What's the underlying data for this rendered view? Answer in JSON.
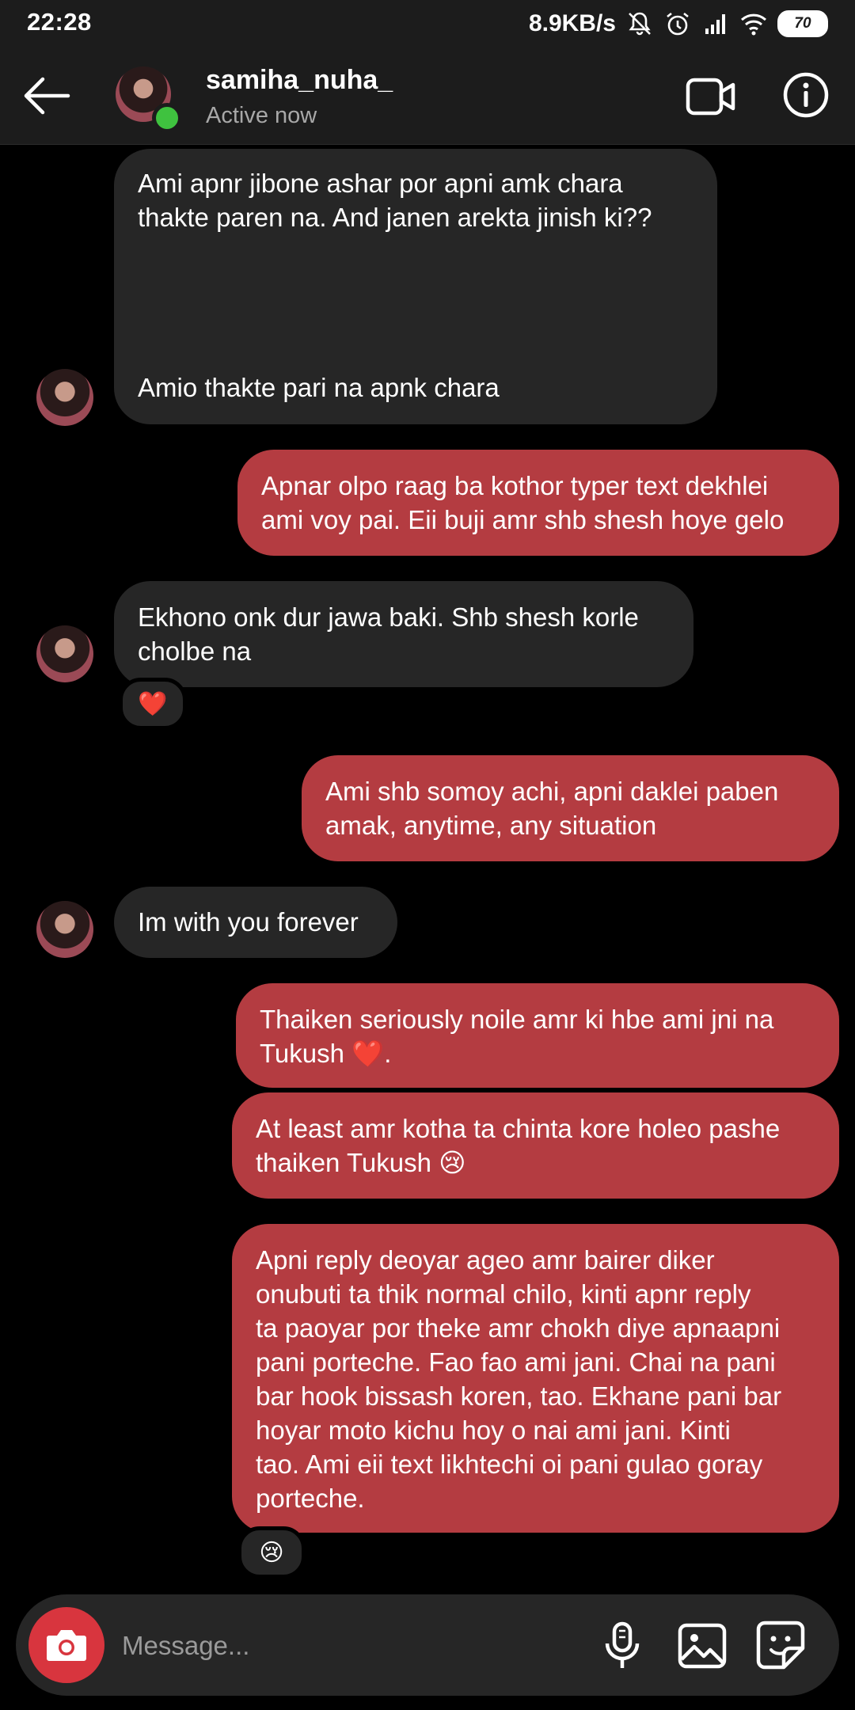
{
  "status_bar": {
    "time": "22:28",
    "net_speed": "8.9KB/s",
    "battery": "70",
    "icons": [
      "mute-icon",
      "alarm-icon",
      "signal-icon",
      "wifi-icon",
      "battery-icon"
    ]
  },
  "header": {
    "username": "samiha_nuha_",
    "status": "Active now",
    "icons": [
      "back-arrow-icon",
      "video-call-icon",
      "info-icon"
    ]
  },
  "messages": [
    {
      "from": "them",
      "text": "Ami apnr jibone ashar por apni amk chara\nthakte paren na. And janen arekta jinish ki??\n\n\n\n\nAmio thakte pari na apnk chara"
    },
    {
      "from": "me",
      "text": "Apnar olpo raag ba kothor typer text dekhlei\nami voy pai. Eii buji amr shb shesh hoye gelo"
    },
    {
      "from": "them",
      "text": "Ekhono onk dur jawa baki. Shb shesh korle\ncholbe na",
      "reaction": "❤️"
    },
    {
      "from": "me",
      "text": "Ami shb somoy achi, apni daklei paben\namak, anytime, any situation"
    },
    {
      "from": "them",
      "text": "Im with you forever"
    },
    {
      "from": "me",
      "text": "Thaiken seriously noile amr ki hbe ami jni na\nTukush ❤️."
    },
    {
      "from": "me",
      "text": "At least amr kotha ta chinta kore holeo pashe\nthaiken Tukush 😢"
    },
    {
      "from": "me",
      "text": "Apni reply deoyar ageo amr bairer diker\nonubuti ta thik normal chilo, kinti apnr reply\nta paoyar por theke amr chokh diye apnaapni\npani porteche. Fao fao ami jani. Chai na pani\nbar hook bissash koren, tao. Ekhane pani bar\nhoyar moto kichu hoy o nai ami jani. Kinti\ntao. Ami eii text likhtechi oi pani gulao goray\nporteche.",
      "reaction": "😢"
    }
  ],
  "composer": {
    "placeholder": "Message...",
    "icons": [
      "camera-icon",
      "microphone-icon",
      "gallery-icon",
      "sticker-icon"
    ]
  },
  "colors": {
    "sent_bubble": "#b43c41",
    "received_bubble": "#262626",
    "background": "#000000",
    "online_dot": "#3fc23f",
    "camera_button": "#d8353e"
  }
}
